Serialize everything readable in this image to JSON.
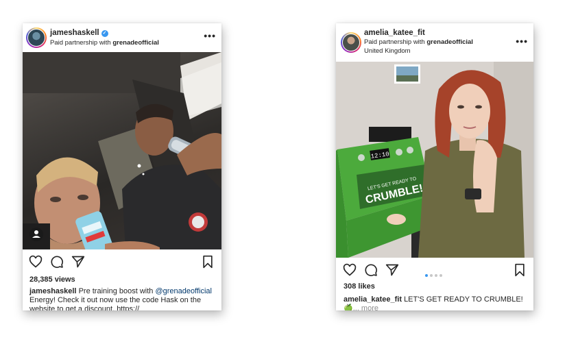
{
  "posts": [
    {
      "username": "jameshaskell",
      "verified": true,
      "partnership_prefix": "Paid partnership with",
      "partner": "grenadeofficial",
      "location": "",
      "menu_icon": "more-dots-icon",
      "actions": [
        "heart-icon",
        "comment-icon",
        "share-icon",
        "bookmark-icon"
      ],
      "stat": "28,385 views",
      "caption_user": "jameshaskell",
      "caption_part1": "Pre training boost with",
      "caption_mention": "@grenadeofficial",
      "caption_part2": "Energy! Check it out now use the code Hask on the website to get a discount.  https://"
    },
    {
      "username": "amelia_katee_fit",
      "verified": false,
      "partnership_prefix": "Paid partnership with",
      "partner": "grenadeofficial",
      "location": "United Kingdom",
      "menu_icon": "more-dots-icon",
      "actions": [
        "heart-icon",
        "comment-icon",
        "share-icon",
        "bookmark-icon"
      ],
      "carousel": {
        "count": 4,
        "active": 1
      },
      "stat": "308 likes",
      "caption_user": "amelia_katee_fit",
      "caption_text": "LET'S GET READY TO CRUMBLE!",
      "caption_emoji": "🍏",
      "caption_more": "... more",
      "box_clock": "12:10",
      "box_text_small": "LET'S GET READY TO",
      "box_text_big": "CRUMBLE!"
    }
  ],
  "colors": {
    "verified_blue": "#3897f0",
    "mention_blue": "#00376b",
    "box_green": "#4caa3c"
  }
}
